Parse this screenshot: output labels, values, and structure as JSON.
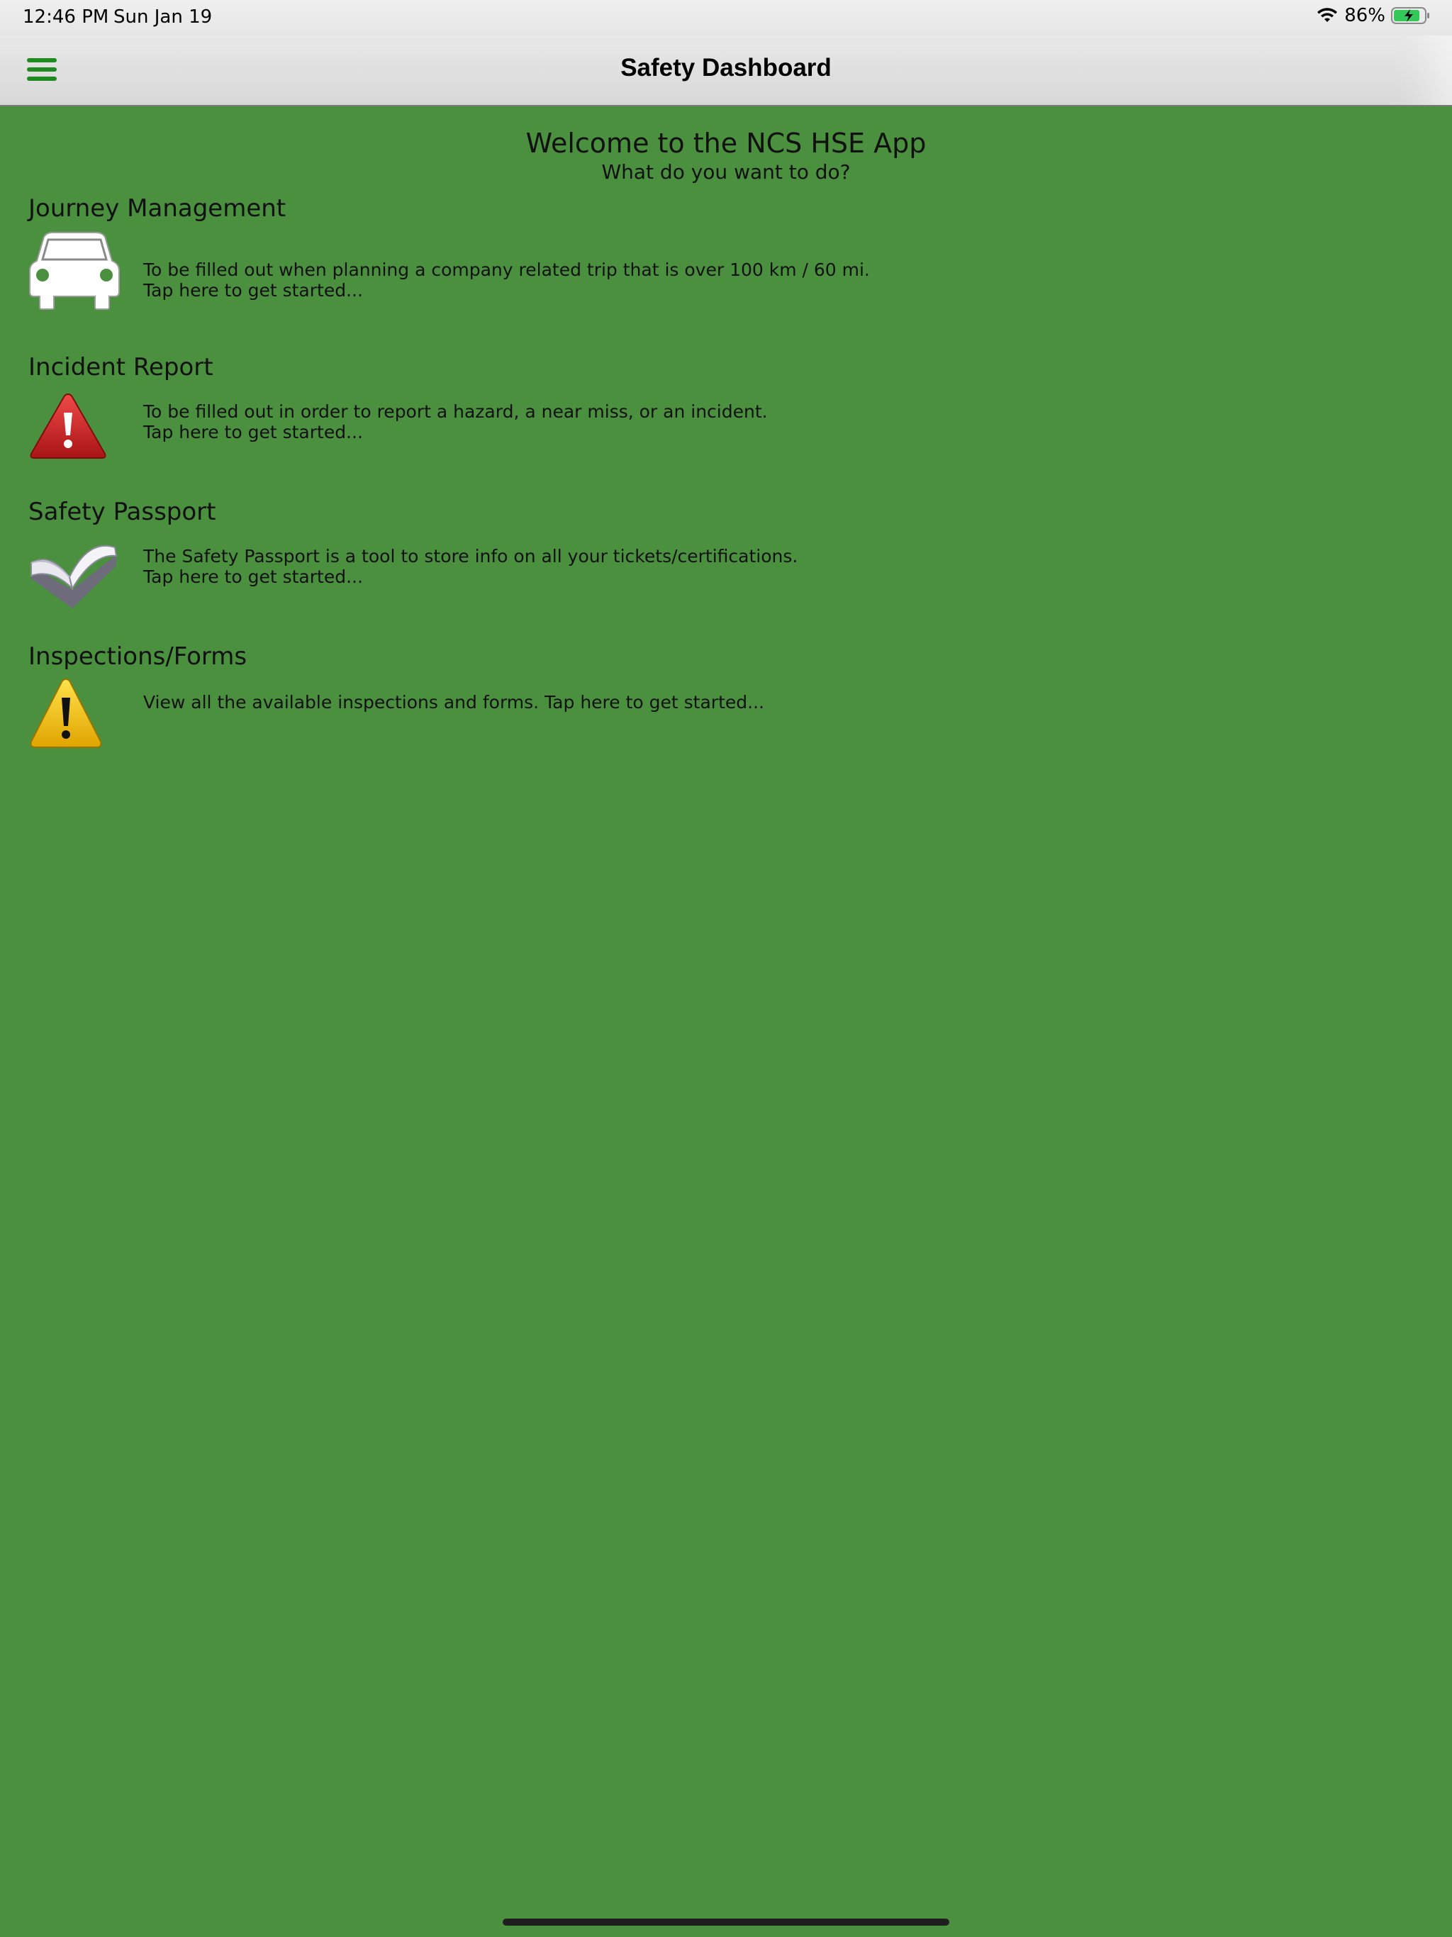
{
  "status_bar": {
    "time": "12:46 PM",
    "date": "Sun Jan 19",
    "battery_percent": "86%",
    "battery_level": 0.86,
    "charging": true,
    "icons": [
      "wifi-icon",
      "battery-icon"
    ]
  },
  "nav": {
    "title": "Safety Dashboard",
    "menu_icon": "hamburger-menu-icon"
  },
  "welcome": {
    "title": "Welcome to the NCS HSE App",
    "subtitle": "What do you want to do?"
  },
  "sections": [
    {
      "title": "Journey Management",
      "icon": "car-icon",
      "line1": "To be filled out when planning a company related trip that is over 100 km / 60 mi.",
      "line2": "Tap here to get started..."
    },
    {
      "title": "Incident Report",
      "icon": "red-warning-icon",
      "line1": "To be filled out in order to report a hazard, a near miss, or an incident.",
      "line2": "Tap here to get started..."
    },
    {
      "title": "Safety Passport",
      "icon": "open-book-icon",
      "line1": "The Safety Passport is a tool to store info on all your tickets/certifications.",
      "line2": "Tap here to get started..."
    },
    {
      "title": "Inspections/Forms",
      "icon": "yellow-warning-icon",
      "line1": "View all the available inspections and forms. Tap here to get started...",
      "line2": ""
    }
  ],
  "colors": {
    "background": "#4a903f",
    "nav_bar": "#dedede",
    "menu_icon": "#1f8a1f",
    "battery_fill": "#34c759"
  }
}
